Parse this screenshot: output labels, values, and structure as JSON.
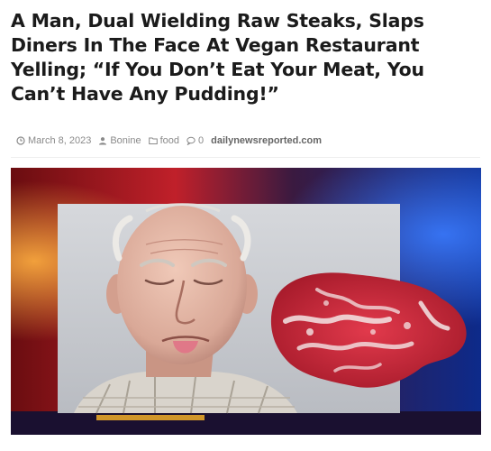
{
  "article": {
    "headline_lines": [
      "A Man, Dual Wielding Raw Steaks, Slaps",
      "Diners In The Face At Vegan Restaurant",
      "Yelling; “If You Don’t Eat Your Meat, You",
      "Can’t Have Any Pudding!”"
    ],
    "meta": {
      "date": "March 8, 2023",
      "author": "Bonine",
      "category": "food",
      "comments": "0",
      "site": "dailynewsreported.com"
    },
    "icons": {
      "date": "clock-icon",
      "author": "user-icon",
      "category": "folder-icon",
      "comments": "comment-icon"
    }
  },
  "photo": {
    "subject": "elderly man with tongue out beside a raw steak",
    "colors": {
      "background_red": "#c0202a",
      "background_blue": "#0d2a8a",
      "panel_gray": "#c9ccd1",
      "steak_red": "#c8283a",
      "fat_white": "#f3e6e6"
    }
  }
}
